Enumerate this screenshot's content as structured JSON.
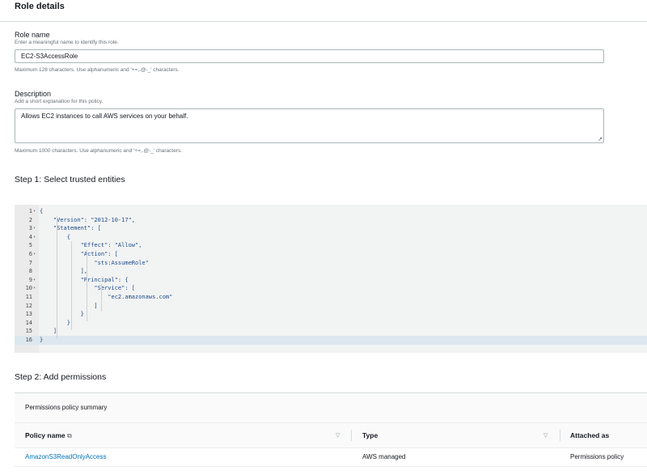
{
  "role_details": {
    "title": "Role details",
    "role_name": {
      "label": "Role name",
      "hint": "Enter a meaningful name to identify this role.",
      "value": "EC2-S3AccessRole",
      "constraint": "Maximum 128 characters. Use alphanumeric and '+=,.@-_' characters."
    },
    "description": {
      "label": "Description",
      "hint": "Add a short explanation for this policy.",
      "value": "Allows EC2 instances to call AWS services on your behalf.",
      "constraint": "Maximum 1000 characters. Use alphanumeric and '+=,.@-_' characters."
    }
  },
  "step1": {
    "title": "Step 1: Select trusted entities",
    "code_lines": [
      {
        "n": "1",
        "fold": true,
        "text": "{"
      },
      {
        "n": "2",
        "fold": false,
        "text": "    \"Version\": \"2012-10-17\","
      },
      {
        "n": "3",
        "fold": true,
        "text": "    \"Statement\": ["
      },
      {
        "n": "4",
        "fold": true,
        "text": "        {"
      },
      {
        "n": "5",
        "fold": false,
        "text": "            \"Effect\": \"Allow\","
      },
      {
        "n": "6",
        "fold": true,
        "text": "            \"Action\": ["
      },
      {
        "n": "7",
        "fold": false,
        "text": "                \"sts:AssumeRole\""
      },
      {
        "n": "8",
        "fold": false,
        "text": "            ],"
      },
      {
        "n": "9",
        "fold": true,
        "text": "            \"Principal\": {"
      },
      {
        "n": "10",
        "fold": true,
        "text": "                \"Service\": ["
      },
      {
        "n": "11",
        "fold": false,
        "text": "                    \"ec2.amazonaws.com\""
      },
      {
        "n": "12",
        "fold": false,
        "text": "                ]"
      },
      {
        "n": "13",
        "fold": false,
        "text": "            }"
      },
      {
        "n": "14",
        "fold": false,
        "text": "        }"
      },
      {
        "n": "15",
        "fold": false,
        "text": "    ]"
      },
      {
        "n": "16",
        "fold": false,
        "text": "}"
      }
    ],
    "active_line": "16"
  },
  "step2": {
    "title": "Step 2: Add permissions",
    "summary_title": "Permissions policy summary",
    "columns": {
      "policy_name": "Policy name",
      "type": "Type",
      "attached_as": "Attached as"
    },
    "rows": [
      {
        "policy_name": "AmazonS3ReadOnlyAccess",
        "type": "AWS managed",
        "attached_as": "Permissions policy"
      }
    ]
  },
  "icons": {
    "external_link": "external-link-icon",
    "sort": "sort-caret-icon",
    "fold": "fold-caret-icon",
    "resize": "resize-grip-icon"
  },
  "colors": {
    "link": "#0073bb",
    "active_line": "#dde7ef",
    "editor_bg": "#f2f3f3"
  }
}
